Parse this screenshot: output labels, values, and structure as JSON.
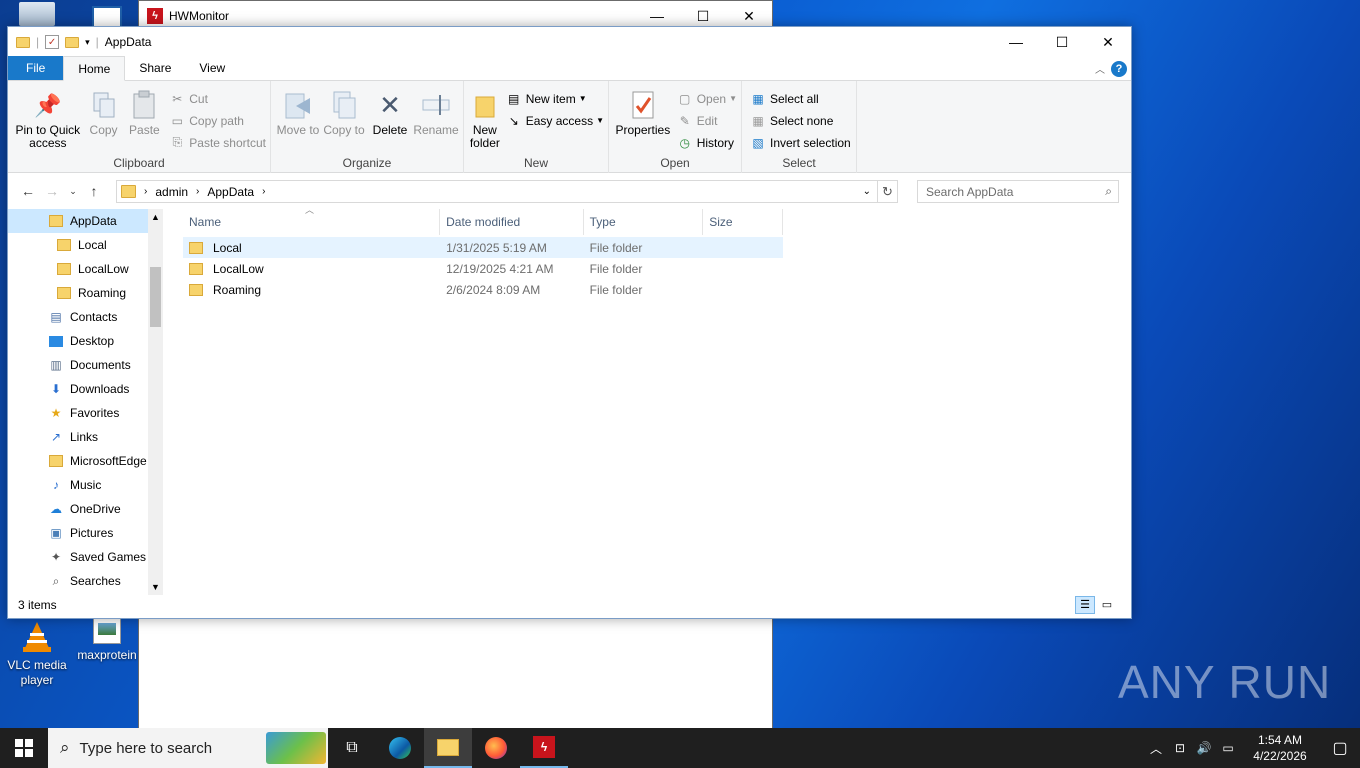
{
  "desktop": {
    "icons": [
      {
        "label": "VLC media player"
      },
      {
        "label": "maxprotein"
      }
    ],
    "watermark": "ANY RUN"
  },
  "hwmonitor": {
    "title": "HWMonitor"
  },
  "explorer": {
    "title": "AppData",
    "tabs": [
      "File",
      "Home",
      "Share",
      "View"
    ],
    "ribbon": {
      "clipboard": {
        "label": "Clipboard",
        "pin": "Pin to Quick access",
        "copy": "Copy",
        "paste": "Paste",
        "cut": "Cut",
        "copy_path": "Copy path",
        "paste_shortcut": "Paste shortcut"
      },
      "organize": {
        "label": "Organize",
        "move_to": "Move to",
        "copy_to": "Copy to",
        "delete": "Delete",
        "rename": "Rename"
      },
      "new": {
        "label": "New",
        "new_folder": "New folder",
        "new_item": "New item",
        "easy_access": "Easy access"
      },
      "open": {
        "label": "Open",
        "properties": "Properties",
        "open": "Open",
        "edit": "Edit",
        "history": "History"
      },
      "select": {
        "label": "Select",
        "select_all": "Select all",
        "select_none": "Select none",
        "invert": "Invert selection"
      }
    },
    "address": {
      "parts": [
        "admin",
        "AppData"
      ]
    },
    "search": {
      "placeholder": "Search AppData"
    },
    "nav": [
      {
        "label": "AppData",
        "icon": "folder-icon",
        "selected": true,
        "indent": 40
      },
      {
        "label": "Local",
        "icon": "folder-icon",
        "indent": 48
      },
      {
        "label": "LocalLow",
        "icon": "folder-icon",
        "indent": 48
      },
      {
        "label": "Roaming",
        "icon": "folder-icon",
        "indent": 48
      },
      {
        "label": "Contacts",
        "icon": "contacts-icon",
        "indent": 40
      },
      {
        "label": "Desktop",
        "icon": "desktop-icon",
        "indent": 40
      },
      {
        "label": "Documents",
        "icon": "documents-icon",
        "indent": 40
      },
      {
        "label": "Downloads",
        "icon": "downloads-icon",
        "indent": 40
      },
      {
        "label": "Favorites",
        "icon": "star-icon",
        "indent": 40
      },
      {
        "label": "Links",
        "icon": "links-icon",
        "indent": 40
      },
      {
        "label": "MicrosoftEdge",
        "icon": "folder-icon",
        "indent": 40
      },
      {
        "label": "Music",
        "icon": "music-icon",
        "indent": 40
      },
      {
        "label": "OneDrive",
        "icon": "onedrive-icon",
        "indent": 40
      },
      {
        "label": "Pictures",
        "icon": "pictures-icon",
        "indent": 40
      },
      {
        "label": "Saved Games",
        "icon": "games-icon",
        "indent": 40
      },
      {
        "label": "Searches",
        "icon": "search-icon",
        "indent": 40
      }
    ],
    "columns": [
      "Name",
      "Date modified",
      "Type",
      "Size"
    ],
    "files": [
      {
        "name": "Local",
        "date": "1/31/2025 5:19 AM",
        "type": "File folder",
        "size": ""
      },
      {
        "name": "LocalLow",
        "date": "12/19/2025 4:21 AM",
        "type": "File folder",
        "size": ""
      },
      {
        "name": "Roaming",
        "date": "2/6/2024 8:09 AM",
        "type": "File folder",
        "size": ""
      }
    ],
    "status": "3 items"
  },
  "taskbar": {
    "search_placeholder": "Type here to search",
    "time": "1:54 AM",
    "date": "4/22/2026"
  }
}
